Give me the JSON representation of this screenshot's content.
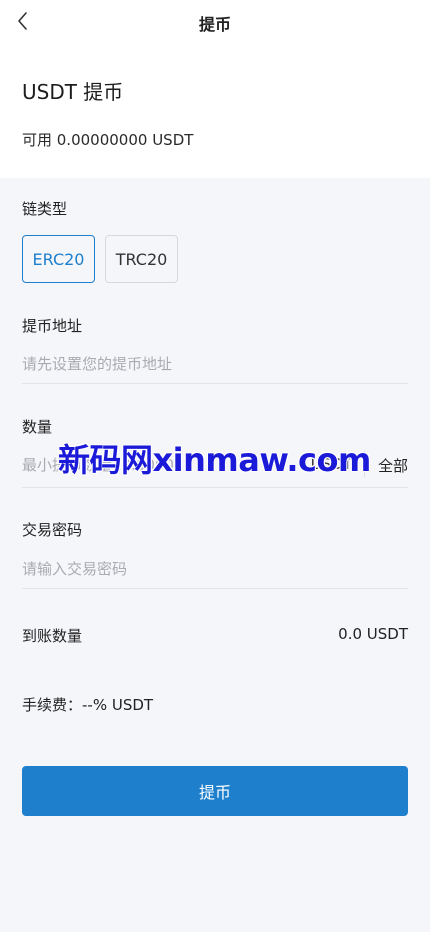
{
  "nav": {
    "title": "提币"
  },
  "header": {
    "heading": "USDT 提币",
    "available": "可用 0.00000000 USDT"
  },
  "chain": {
    "label": "链类型",
    "options": [
      "ERC20",
      "TRC20"
    ],
    "selected": "ERC20"
  },
  "address": {
    "label": "提币地址",
    "placeholder": "请先设置您的提币地址",
    "value": ""
  },
  "amount": {
    "label": "数量",
    "placeholder": "最小提币数量10.0000",
    "value": "",
    "unit": "USDT",
    "all_label": "全部"
  },
  "password": {
    "label": "交易密码",
    "placeholder": "请输入交易密码",
    "value": ""
  },
  "received": {
    "label": "到账数量",
    "value": "0.0 USDT"
  },
  "fee": {
    "text": "手续费：--% USDT"
  },
  "submit": {
    "label": "提币"
  },
  "watermark": {
    "text": "新码网xinmaw.com"
  },
  "colors": {
    "accent": "#1e7fcc",
    "background": "#f5f6fa",
    "watermark": "#1a1ad8"
  }
}
